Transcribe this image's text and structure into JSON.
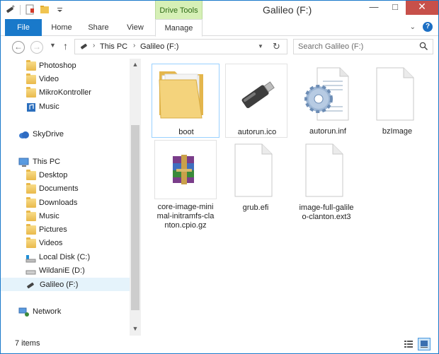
{
  "window": {
    "title": "Galileo (F:)"
  },
  "ribbon": {
    "context_tab": "Drive Tools",
    "tabs": [
      "File",
      "Home",
      "Share",
      "View",
      "Manage"
    ]
  },
  "address": {
    "crumbs": [
      "This PC",
      "Galileo (F:)"
    ]
  },
  "search": {
    "placeholder": "Search Galileo (F:)"
  },
  "navpane": {
    "items": [
      {
        "label": "Photoshop",
        "icon": "folder-icon"
      },
      {
        "label": "Video",
        "icon": "folder-icon"
      },
      {
        "label": "MikroKontroller",
        "icon": "folder-icon"
      },
      {
        "label": "Music",
        "icon": "music-icon"
      },
      {
        "label": "SkyDrive",
        "icon": "skydrive-icon"
      },
      {
        "label": "This PC",
        "icon": "computer-icon"
      },
      {
        "label": "Desktop",
        "icon": "desktop-icon"
      },
      {
        "label": "Documents",
        "icon": "documents-icon"
      },
      {
        "label": "Downloads",
        "icon": "downloads-icon"
      },
      {
        "label": "Music",
        "icon": "music-icon"
      },
      {
        "label": "Pictures",
        "icon": "pictures-icon"
      },
      {
        "label": "Videos",
        "icon": "videos-icon"
      },
      {
        "label": "Local Disk (C:)",
        "icon": "drive-icon"
      },
      {
        "label": "WildaniE (D:)",
        "icon": "drive-icon"
      },
      {
        "label": "Galileo (F:)",
        "icon": "usb-drive-icon"
      },
      {
        "label": "Network",
        "icon": "network-icon"
      }
    ]
  },
  "files": [
    {
      "name": "boot",
      "type": "folder"
    },
    {
      "name": "autorun.ico",
      "type": "icon-file"
    },
    {
      "name": "autorun.inf",
      "type": "settings-file"
    },
    {
      "name": "bzImage",
      "type": "file"
    },
    {
      "name_lines": [
        "core-image-mini",
        "mal-initramfs-cla",
        "nton.cpio.gz"
      ],
      "type": "archive"
    },
    {
      "name": "grub.efi",
      "type": "file"
    },
    {
      "name_lines": [
        "image-full-galile",
        "o-clanton.ext3"
      ],
      "type": "file"
    }
  ],
  "status": {
    "item_count": "7 items"
  },
  "colors": {
    "accent": "#1979ca",
    "context_tab": "#d6f0b6",
    "selection": "#99d1ff",
    "close": "#c7504a"
  }
}
